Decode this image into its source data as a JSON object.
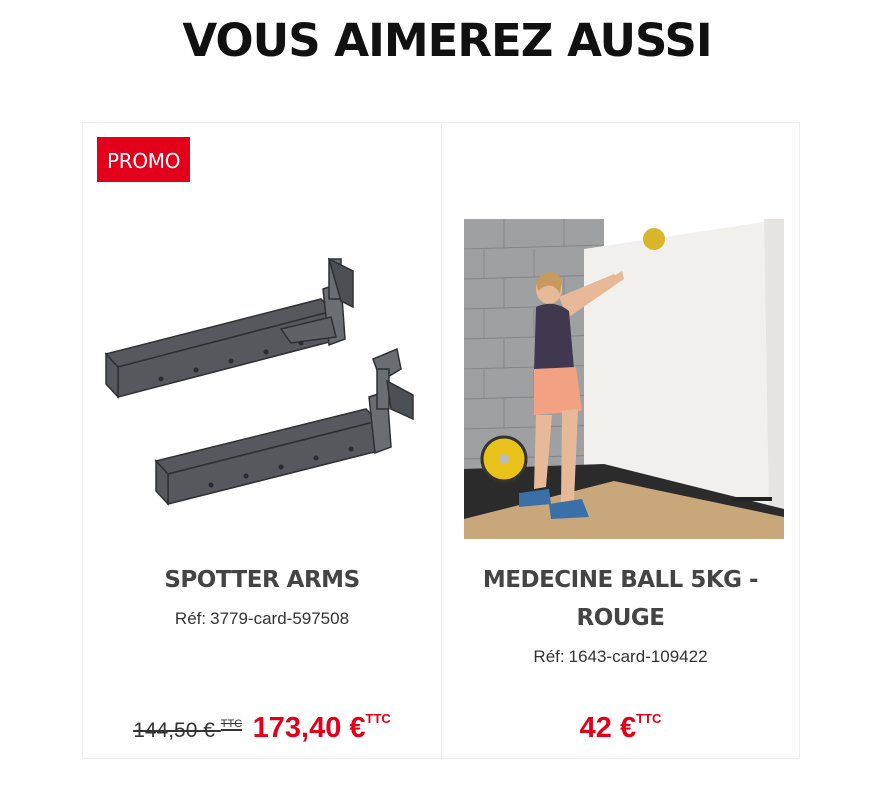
{
  "section": {
    "title": "VOUS AIMEREZ AUSSI"
  },
  "products": [
    {
      "badge": "PROMO",
      "name_lines": [
        "SPOTTER ARMS"
      ],
      "ref_label": "Réf:",
      "ref_value": "3779-card-597508",
      "old_price": "144,50 €",
      "old_price_unit": "TTC",
      "price": "173,40 €",
      "price_unit": "TTC",
      "image": "spotter-arms-product-photo"
    },
    {
      "badge": "",
      "name_lines": [
        "MEDECINE BALL 5KG -",
        "ROUGE"
      ],
      "ref_label": "Réf:",
      "ref_value": "1643-card-109422",
      "price": "42 €",
      "price_unit": "TTC",
      "image": "woman-throwing-medicine-ball-photo"
    }
  ],
  "colors": {
    "promo": "#e2001a",
    "price": "#e2001a",
    "title": "#111111",
    "name": "#444444"
  }
}
